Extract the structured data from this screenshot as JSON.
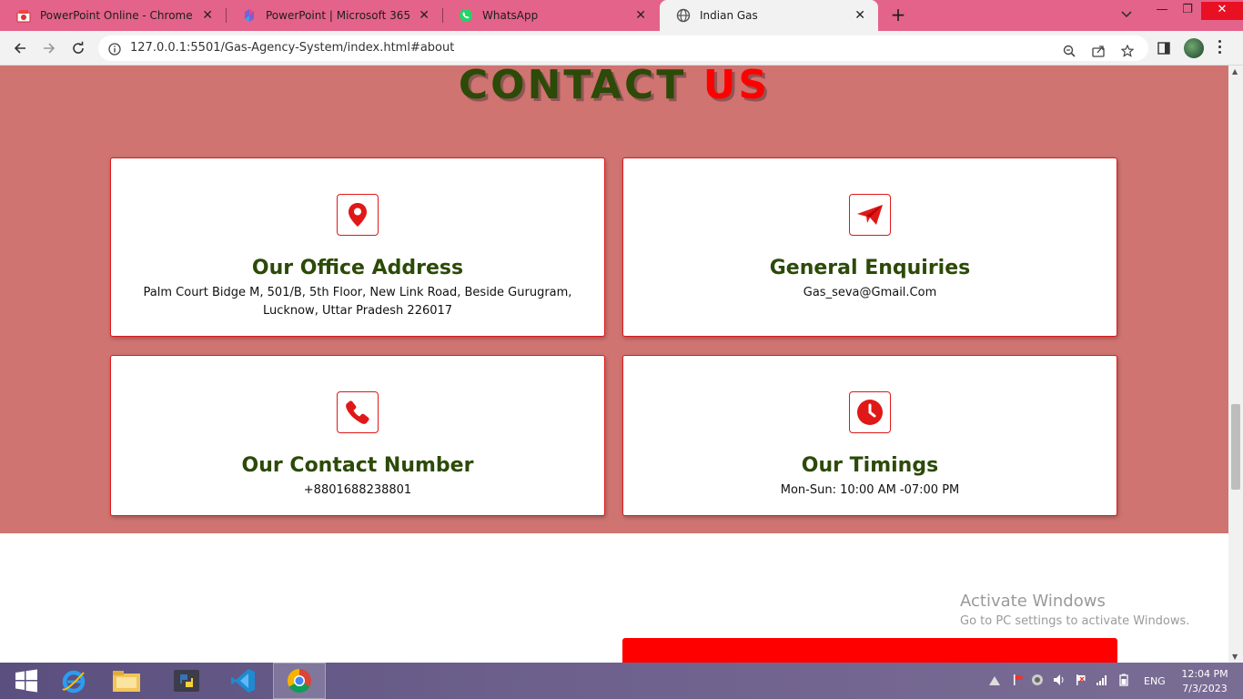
{
  "browser": {
    "tabs": [
      {
        "title": "PowerPoint Online - Chrome Web",
        "icon": "chrome-web-store-icon"
      },
      {
        "title": "PowerPoint | Microsoft 365",
        "icon": "microsoft-365-icon"
      },
      {
        "title": "WhatsApp",
        "icon": "whatsapp-icon"
      },
      {
        "title": "Indian Gas",
        "icon": "globe-icon"
      }
    ],
    "new_tab": "+",
    "url": "127.0.0.1:5501/Gas-Agency-System/index.html#about",
    "colors": {
      "tabstrip": "#e4638a",
      "toolbar": "#f2f2f2"
    }
  },
  "page": {
    "heading": {
      "word1": "CONTACT",
      "word2": "US"
    },
    "cards": [
      {
        "icon": "location-pin-icon",
        "title": "Our Office Address",
        "text": "Palm Court Bidge M, 501/B, 5th Floor, New Link Road, Beside Gurugram, Lucknow, Uttar Pradesh 226017"
      },
      {
        "icon": "paper-plane-icon",
        "title": "General Enquiries",
        "text": "Gas_seva@Gmail.Com"
      },
      {
        "icon": "phone-icon",
        "title": "Our Contact Number",
        "text": "+8801688238801"
      },
      {
        "icon": "clock-icon",
        "title": "Our Timings",
        "text": "Mon-Sun: 10:00 AM -07:00 PM"
      }
    ],
    "colors": {
      "section_bg": "#cf7471",
      "heading_dark": "#2c4a08",
      "accent": "#ff0000"
    }
  },
  "watermark": {
    "line1": "Activate Windows",
    "line2": "Go to PC settings to activate Windows."
  },
  "taskbar": {
    "apps": [
      "windows-start-icon",
      "internet-explorer-icon",
      "file-explorer-icon",
      "python-icon",
      "vscode-icon",
      "chrome-icon"
    ],
    "language": "ENG",
    "time": "12:04 PM",
    "date": "7/3/2023"
  }
}
